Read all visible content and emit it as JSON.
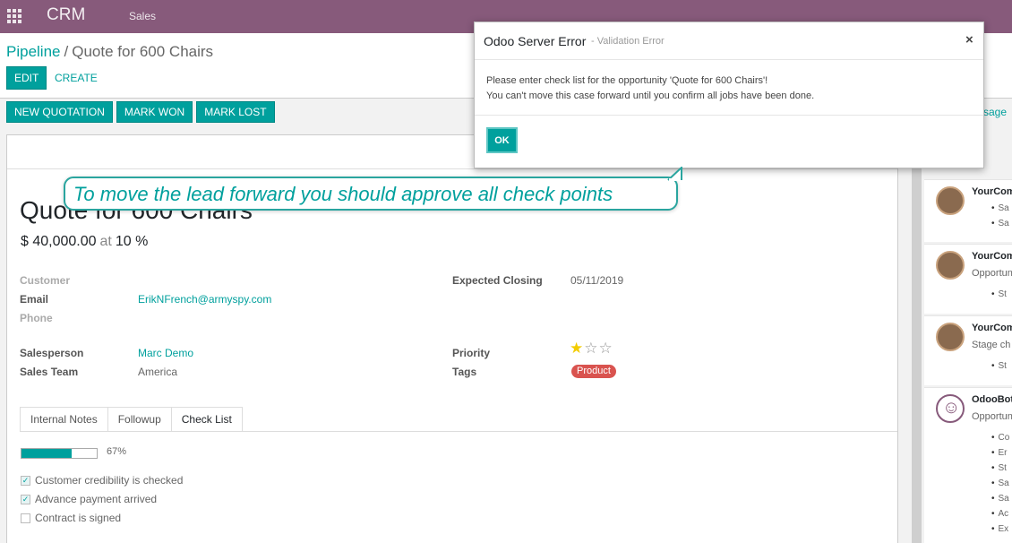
{
  "navbar": {
    "app": "CRM",
    "menu": "Sales"
  },
  "breadcrumb": {
    "parent": "Pipeline",
    "separator": "/",
    "current": "Quote for 600 Chairs"
  },
  "control": {
    "edit": "EDIT",
    "create": "CREATE"
  },
  "statusbar": {
    "buttons": [
      "NEW QUOTATION",
      "MARK WON",
      "MARK LOST"
    ]
  },
  "record": {
    "title": "Quote for 600 Chairs",
    "revenue": "$ 40,000.00",
    "at": "at",
    "probability": "10 %",
    "fields": {
      "customer_label": "Customer",
      "email_label": "Email",
      "email_value": "ErikNFrench@armyspy.com",
      "phone_label": "Phone",
      "salesperson_label": "Salesperson",
      "salesperson_value": "Marc Demo",
      "team_label": "Sales Team",
      "team_value": "America",
      "closing_label": "Expected Closing",
      "closing_value": "05/11/2019",
      "priority_label": "Priority",
      "priority_stars": 1,
      "priority_max": 3,
      "tags_label": "Tags",
      "tag": "Product"
    },
    "tabs": [
      "Internal Notes",
      "Followup",
      "Check List"
    ],
    "active_tab": "Check List",
    "progress_value": 67,
    "progress_text": "67%",
    "checklist": [
      {
        "label": "Customer credibility is checked",
        "checked": true
      },
      {
        "label": "Advance payment arrived",
        "checked": true
      },
      {
        "label": "Contract is signed",
        "checked": false
      }
    ]
  },
  "chatter": {
    "send_message": "sage",
    "messages": [
      {
        "author": "YourCom",
        "sub": "",
        "bullets": [
          "Sa",
          "Sa"
        ]
      },
      {
        "author": "YourCom",
        "sub": "Opportun",
        "bullets": [
          "St"
        ]
      },
      {
        "author": "YourCom",
        "sub": "Stage ch",
        "bullets": [
          "St"
        ]
      },
      {
        "author": "OdooBot",
        "sub": "Opportun",
        "bullets": [
          "Co",
          "Er",
          "St",
          "Sa",
          "Sa",
          "Ac",
          "Ex"
        ]
      }
    ]
  },
  "dialog": {
    "title": "Odoo Server Error",
    "subtitle": "- Validation Error",
    "close": "×",
    "line1": "Please enter check list for the opportunity 'Quote for 600 Chairs'!",
    "line2": "You can't move this case forward until you confirm all jobs have been done.",
    "ok": "OK"
  },
  "callout": {
    "text": "To move the lead forward you should approve all check points"
  },
  "colors": {
    "brand": "#875a7b",
    "accent": "#00a09d",
    "tag": "#d9534f",
    "star": "#f3cc00"
  }
}
